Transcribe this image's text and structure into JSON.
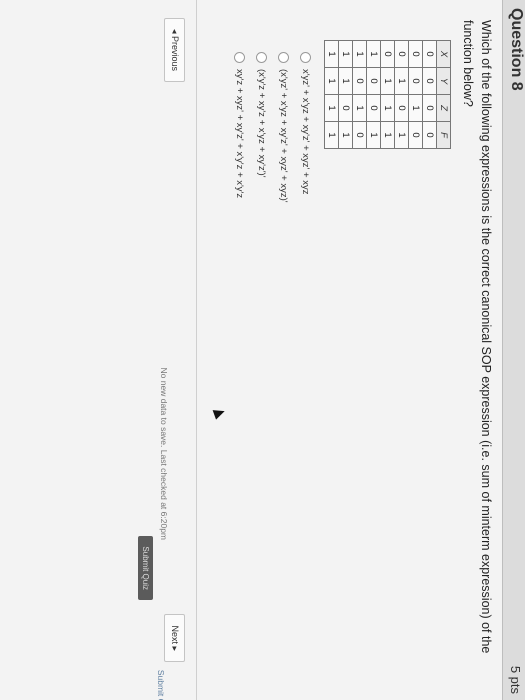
{
  "question": {
    "title": "Question 8",
    "points": "5 pts",
    "text": "Which of the following expressions is the correct canonical SOP expression (i.e. sum of minterm expression) of the function below?"
  },
  "truth_table": {
    "headers": [
      "X",
      "Y",
      "Z",
      "F"
    ],
    "rows": [
      [
        "0",
        "0",
        "0",
        "0"
      ],
      [
        "0",
        "0",
        "1",
        "0"
      ],
      [
        "0",
        "1",
        "0",
        "1"
      ],
      [
        "0",
        "1",
        "1",
        "1"
      ],
      [
        "1",
        "0",
        "0",
        "1"
      ],
      [
        "1",
        "0",
        "1",
        "0"
      ],
      [
        "1",
        "1",
        "0",
        "1"
      ],
      [
        "1",
        "1",
        "1",
        "1"
      ]
    ]
  },
  "options": [
    "x'yz' + x'yz + xy'z' + xyz' + xyz",
    "(x'yz' + x'yz + xy'z' + xyz' + xyz)'",
    "(x'y'z + xy'z + x'yz + xy'z')'",
    "xy'z + xyz' + xy'z' + x'y'z + x'y'z"
  ],
  "nav": {
    "previous": "◂ Previous",
    "next": "Next ▸"
  },
  "status": "No new data to save. Last checked at 6:20pm",
  "save_button": "Submit Quiz",
  "submit_link": "Submit Qu"
}
